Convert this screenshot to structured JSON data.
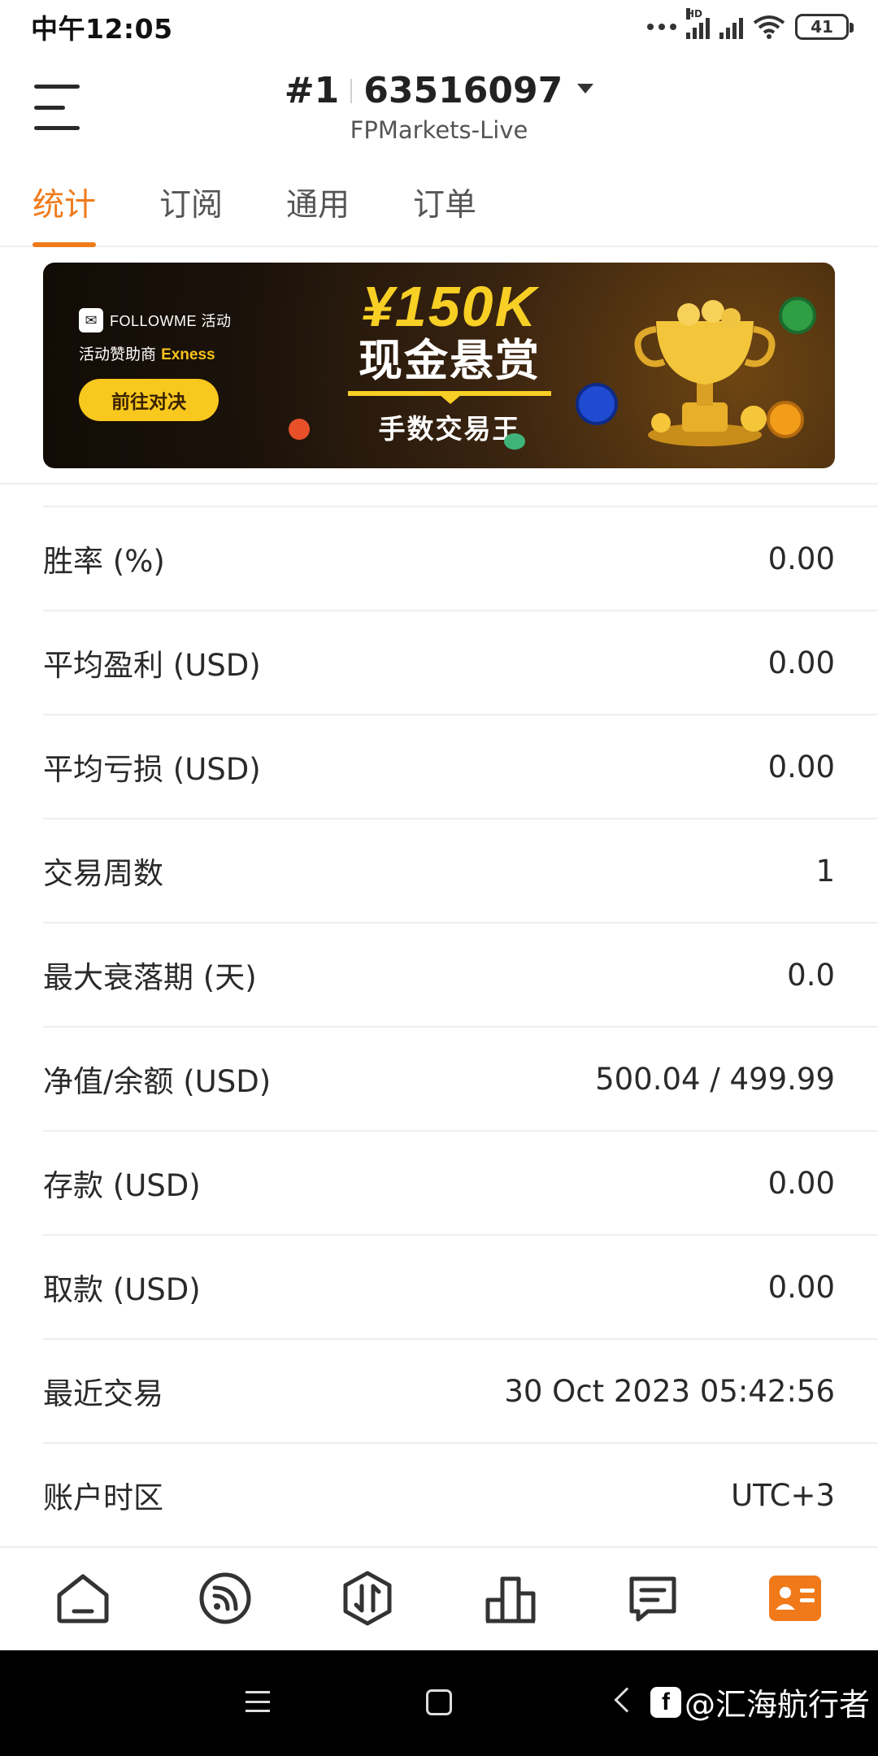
{
  "status_bar": {
    "time": "中午12:05",
    "network_badge": "HD",
    "battery": "41",
    "icons": [
      "more-dots-icon",
      "signal-icon",
      "signal-icon",
      "wifi-icon",
      "battery-icon"
    ]
  },
  "header": {
    "rank": "#1",
    "account_number": "63516097",
    "server": "FPMarkets-Live",
    "icons": [
      "menu-icon",
      "dropdown-caret-icon"
    ]
  },
  "tabs": [
    {
      "label": "统计",
      "active": true
    },
    {
      "label": "订阅",
      "active": false
    },
    {
      "label": "通用",
      "active": false
    },
    {
      "label": "订单",
      "active": false
    }
  ],
  "accent_color": "#f07a1a",
  "banner": {
    "brand": "FOLLOWME 活动",
    "sponsor_prefix": "活动赞助商",
    "sponsor_name": "Exness",
    "button": "前往对决",
    "amount": "¥150K",
    "title": "现金悬赏",
    "subtitle": "手数交易王"
  },
  "stats": [
    {
      "label": "胜率 (%)",
      "value": "0.00"
    },
    {
      "label": "平均盈利 (USD)",
      "value": "0.00"
    },
    {
      "label": "平均亏损 (USD)",
      "value": "0.00"
    },
    {
      "label": "交易周数",
      "value": "1"
    },
    {
      "label": "最大衰落期 (天)",
      "value": "0.0"
    },
    {
      "label": "净值/余额 (USD)",
      "value": "500.04 / 499.99"
    },
    {
      "label": "存款 (USD)",
      "value": "0.00"
    },
    {
      "label": "取款 (USD)",
      "value": "0.00"
    },
    {
      "label": "最近交易",
      "value": "30 Oct 2023 05:42:56"
    },
    {
      "label": "账户时区",
      "value": "UTC+3"
    }
  ],
  "bottom_nav": [
    {
      "icon": "home-icon",
      "active": false
    },
    {
      "icon": "feed-icon",
      "active": false
    },
    {
      "icon": "trade-icon",
      "active": false
    },
    {
      "icon": "ranking-icon",
      "active": false
    },
    {
      "icon": "message-icon",
      "active": false
    },
    {
      "icon": "profile-card-icon",
      "active": true
    }
  ],
  "system_nav": {
    "watermark": "@汇海航行者"
  }
}
